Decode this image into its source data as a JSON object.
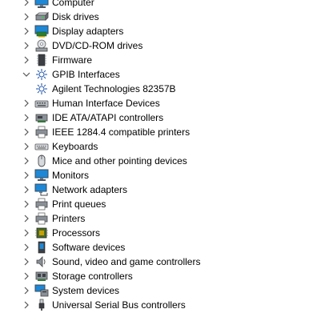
{
  "tree": {
    "items": [
      {
        "label": "Computer",
        "icon": "computer-icon",
        "expanded": false
      },
      {
        "label": "Disk drives",
        "icon": "disk-drive-icon",
        "expanded": false
      },
      {
        "label": "Display adapters",
        "icon": "display-adapter-icon",
        "expanded": false
      },
      {
        "label": "DVD/CD-ROM drives",
        "icon": "dvd-drive-icon",
        "expanded": false
      },
      {
        "label": "Firmware",
        "icon": "firmware-icon",
        "expanded": false
      },
      {
        "label": "GPIB Interfaces",
        "icon": "gpib-icon",
        "expanded": true,
        "children": [
          {
            "label": "Agilent Technologies 82357B",
            "icon": "gpib-device-icon"
          }
        ]
      },
      {
        "label": "Human Interface Devices",
        "icon": "hid-icon",
        "expanded": false
      },
      {
        "label": "IDE ATA/ATAPI controllers",
        "icon": "ide-controller-icon",
        "expanded": false
      },
      {
        "label": "IEEE 1284.4 compatible printers",
        "icon": "ieee-printer-icon",
        "expanded": false
      },
      {
        "label": "Keyboards",
        "icon": "keyboard-icon",
        "expanded": false
      },
      {
        "label": "Mice and other pointing devices",
        "icon": "mouse-icon",
        "expanded": false
      },
      {
        "label": "Monitors",
        "icon": "monitor-icon",
        "expanded": false
      },
      {
        "label": "Network adapters",
        "icon": "network-adapter-icon",
        "expanded": false
      },
      {
        "label": "Print queues",
        "icon": "print-queue-icon",
        "expanded": false
      },
      {
        "label": "Printers",
        "icon": "printer-icon",
        "expanded": false
      },
      {
        "label": "Processors",
        "icon": "processor-icon",
        "expanded": false
      },
      {
        "label": "Software devices",
        "icon": "software-device-icon",
        "expanded": false
      },
      {
        "label": "Sound, video and game controllers",
        "icon": "sound-icon",
        "expanded": false
      },
      {
        "label": "Storage controllers",
        "icon": "storage-controller-icon",
        "expanded": false
      },
      {
        "label": "System devices",
        "icon": "system-device-icon",
        "expanded": false
      },
      {
        "label": "Universal Serial Bus controllers",
        "icon": "usb-icon",
        "expanded": false
      }
    ]
  },
  "colors": {
    "text": "#000000",
    "chevron": "#555555",
    "monitor_blue": "#1e88d6",
    "background": "#ffffff"
  }
}
